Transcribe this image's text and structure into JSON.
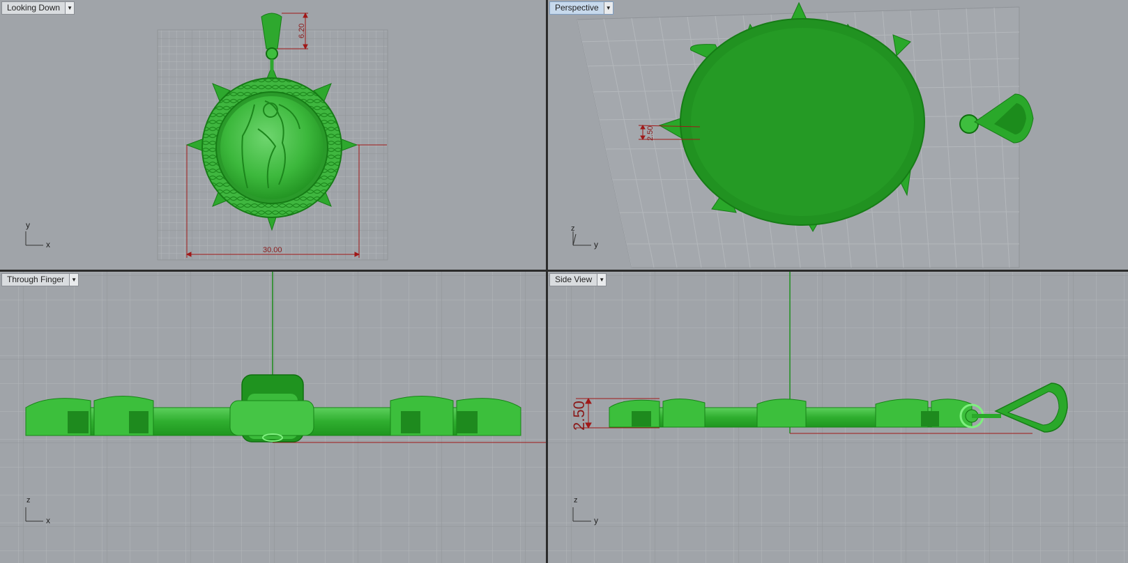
{
  "viewports": {
    "top_left": {
      "title": "Looking Down",
      "axis_v": "y",
      "axis_h": "x"
    },
    "top_right": {
      "title": "Perspective",
      "axis_v": "z",
      "axis_h": "y"
    },
    "bottom_left": {
      "title": "Through Finger",
      "axis_v": "z",
      "axis_h": "x"
    },
    "bottom_right": {
      "title": "Side View",
      "axis_v": "z",
      "axis_h": "y"
    }
  },
  "dimensions": {
    "bail_height": "6.20",
    "pendant_width": "30.00",
    "thickness_perspective": "2.50",
    "thickness_side": "2.50"
  },
  "colors": {
    "viewport_bg": "#a0a4a9",
    "grid_minor": "#b0b4b8",
    "grid_major": "#8d9196",
    "model_green": "#2aa82a",
    "model_dark": "#178317",
    "dimension_red": "#a01818",
    "active_tab": "#c7d9ec"
  }
}
